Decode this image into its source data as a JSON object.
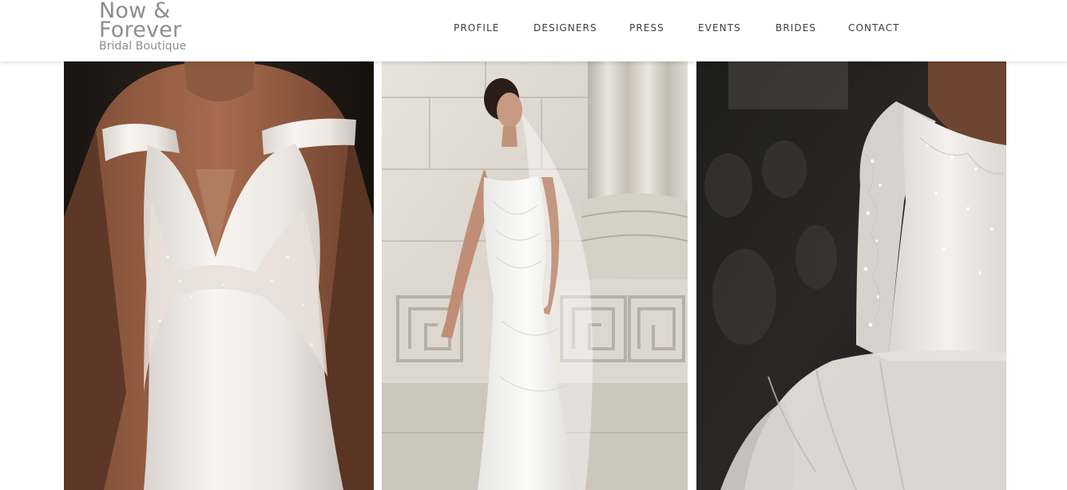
{
  "site": {
    "logo_line1": "Now &",
    "logo_line2": "Forever",
    "logo_line3": "Bridal Boutique"
  },
  "nav": [
    {
      "label": "PROFILE"
    },
    {
      "label": "DESIGNERS"
    },
    {
      "label": "PRESS"
    },
    {
      "label": "EVENTS"
    },
    {
      "label": "BRIDES"
    },
    {
      "label": "CONTACT"
    }
  ],
  "gallery": {
    "photos": [
      {
        "subject": "off-shoulder satin gown with lace bodice on runway"
      },
      {
        "subject": "bride in strapless tulle gown against marble columns"
      },
      {
        "subject": "beaded lace long-sleeve ball gown on runway"
      }
    ]
  },
  "colors": {
    "logo": "#8d8d8d",
    "nav_text": "#3c3c3c",
    "background": "#ffffff"
  }
}
